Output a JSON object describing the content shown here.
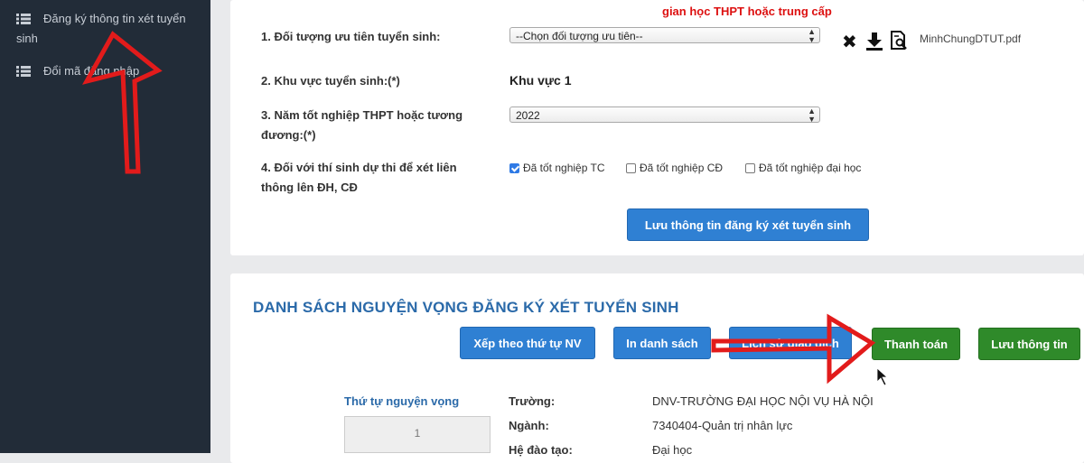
{
  "sidebar": {
    "items": [
      {
        "label_line1": "Đăng ký thông tin xét tuyển",
        "label_line2": "sinh"
      },
      {
        "label": "Đổi mã đăng nhập"
      }
    ]
  },
  "form": {
    "notice": "gian học THPT hoặc trung cấp",
    "q1_label": "1. Đối tượng ưu tiên tuyển sinh:",
    "q1_select": "--Chọn đối tượng ưu tiên--",
    "file_name": "MinhChungDTUT.pdf",
    "q2_label": "2. Khu vực tuyển sinh:(*)",
    "q2_value": "Khu vực 1",
    "q3_label_line1": "3. Năm tốt nghiệp THPT hoặc tương",
    "q3_label_line2": "đương:(*)",
    "q3_select": "2022",
    "q4_label_line1": "4. Đối với thí sinh dự thi để xét liên",
    "q4_label_line2": "thông lên ĐH, CĐ",
    "checkboxes": [
      {
        "label": "Đã tốt nghiệp TC",
        "checked": true
      },
      {
        "label": "Đã tốt nghiệp CĐ",
        "checked": false
      },
      {
        "label": "Đã tốt nghiệp đại học",
        "checked": false
      }
    ],
    "save_button": "Lưu thông tin đăng ký xét tuyển sinh"
  },
  "list": {
    "title": "DANH SÁCH NGUYỆN VỌNG ĐĂNG KÝ XÉT TUYỂN SINH",
    "buttons": {
      "sort": "Xếp theo thứ tự NV",
      "print": "In danh sách",
      "history": "Lịch sử giao dịch",
      "pay": "Thanh toán",
      "save": "Lưu thông tin"
    },
    "order_label": "Thứ tự nguyện vọng",
    "order_value": "1",
    "rows": [
      {
        "label": "Trường:",
        "value": "DNV-TRƯỜNG ĐẠI HỌC NỘI VỤ HÀ NỘI"
      },
      {
        "label": "Ngành:",
        "value": "7340404-Quản trị nhân lực"
      },
      {
        "label": "Hệ đào tạo:",
        "value": "Đại học"
      }
    ]
  },
  "colors": {
    "sidebar": "#222c38",
    "accent_blue": "#2f80d3",
    "accent_green": "#2f8a2a",
    "annotation_red": "#e21b1b"
  },
  "icons": [
    "list-icon",
    "close-icon",
    "download-icon",
    "file-search-icon"
  ]
}
